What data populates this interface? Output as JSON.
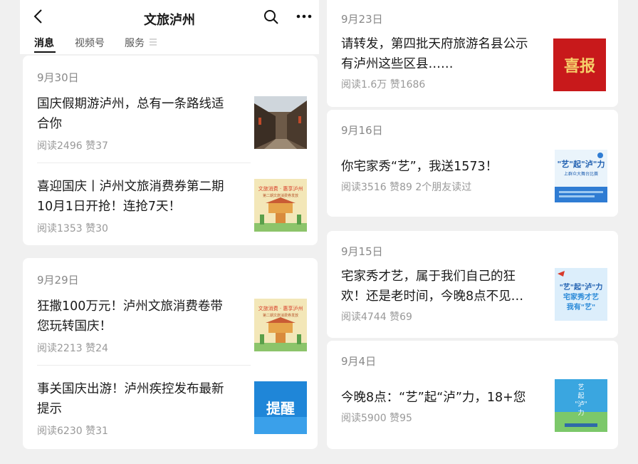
{
  "header": {
    "title": "文旅泸州"
  },
  "tabs": [
    {
      "label": "消息"
    },
    {
      "label": "视频号"
    },
    {
      "label": "服务"
    }
  ],
  "thumbnails": {
    "festival": {
      "line1": "文旅消费 · 惠享泸州",
      "line2": "第二期文旅消费券发放"
    },
    "ti_xing": "提醒",
    "xi_bao": "喜报",
    "yi_qi": {
      "line1": "\"艺\"起\"泸\"力",
      "line2": "上群众大舞台比赛"
    },
    "zhai_jia": {
      "line1": "\"艺\"起\"泸\"力",
      "line2": "宅家秀才艺",
      "line3": "我有\"艺\""
    },
    "qi_lu": {
      "line1": "艺",
      "line2": "起",
      "line3": "\"泸\"",
      "line4": "力"
    }
  },
  "left": {
    "groups": [
      {
        "date": "9月30日",
        "articles": [
          {
            "title_lines": [
              "国庆假期游泸州，总有一条路线适",
              "合你"
            ],
            "stats": "阅读2496  赞37"
          },
          {
            "title_lines": [
              "喜迎国庆丨泸州文旅消费券第二期",
              "10月1日开抢！连抢7天！"
            ],
            "stats": "阅读1353  赞30"
          }
        ]
      },
      {
        "date": "9月29日",
        "articles": [
          {
            "title_lines": [
              "狂撒100万元！泸州文旅消费卷带",
              "您玩转国庆！"
            ],
            "stats": "阅读2213  赞24"
          },
          {
            "title_lines": [
              "事关国庆出游！泸州疾控发布最新",
              "提示"
            ],
            "stats": "阅读6230  赞31"
          }
        ]
      }
    ]
  },
  "right": {
    "groups": [
      {
        "date": "9月23日",
        "articles": [
          {
            "title_lines": [
              "请转发，第四批天府旅游名县公示",
              "有泸州这些区县……"
            ],
            "stats": "阅读1.6万  赞1686"
          }
        ]
      },
      {
        "date": "9月16日",
        "articles": [
          {
            "title_lines": [
              "你宅家秀“艺”，我送1573！"
            ],
            "stats": "阅读3516  赞89  2个朋友读过"
          }
        ]
      },
      {
        "date": "9月15日",
        "articles": [
          {
            "title_lines": [
              "宅家秀才艺，属于我们自己的狂",
              "欢！还是老时间，今晚8点不见…"
            ],
            "stats": "阅读4744  赞69"
          }
        ]
      },
      {
        "date": "9月4日",
        "articles": [
          {
            "title_lines": [
              "今晚8点：“艺”起“泸”力，18+您"
            ],
            "stats": "阅读5900  赞95"
          }
        ]
      }
    ]
  }
}
